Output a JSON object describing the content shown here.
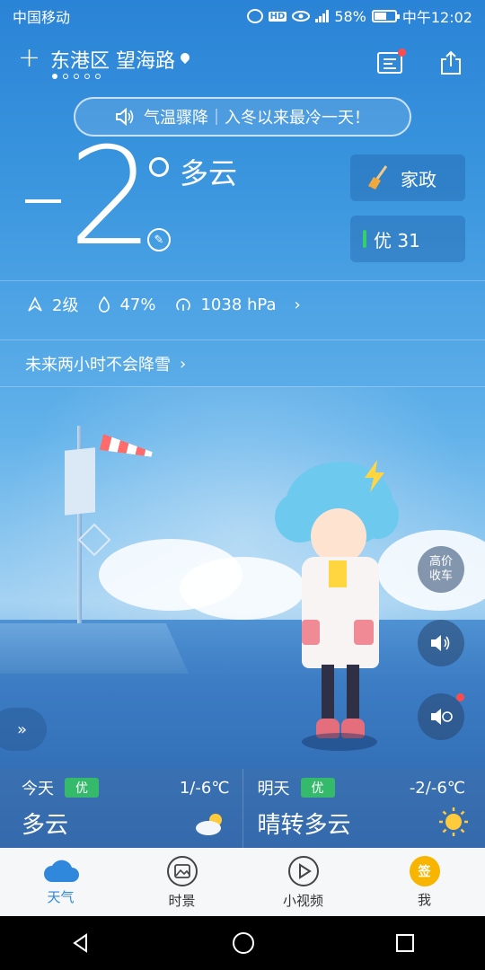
{
  "status_bar": {
    "carrier": "中国移动",
    "hd_label": "HD",
    "battery_percent": "58%",
    "battery_level": 0.58,
    "time": "中午12:02"
  },
  "header": {
    "location": "东港区 望海路",
    "page_count": 5,
    "active_page": 0
  },
  "alert": {
    "text": "气温骤降｜入冬以来最冷一天！"
  },
  "current": {
    "minus": "-",
    "temp": "2",
    "condition": "多云"
  },
  "side_cards": {
    "housekeeping_label": "家政",
    "aqi_label": "优 31"
  },
  "stats": {
    "wind": "2级",
    "humidity": "47%",
    "pressure": "1038 hPa"
  },
  "precip_note": "未来两小时不会降雪",
  "right_buttons": {
    "car_label_1": "高价",
    "car_label_2": "收车"
  },
  "forecast": {
    "today": {
      "day": "今天",
      "aqi": "优",
      "range": "1/-6℃",
      "condition": "多云",
      "icon": "partly-cloudy-icon"
    },
    "tomorrow": {
      "day": "明天",
      "aqi": "优",
      "range": "-2/-6℃",
      "condition": "晴转多云",
      "icon": "sun-icon"
    }
  },
  "nav": {
    "items": [
      {
        "label": "天气",
        "icon": "cloud-icon",
        "active": true
      },
      {
        "label": "时景",
        "icon": "photo-icon"
      },
      {
        "label": "小视频",
        "icon": "play-icon"
      },
      {
        "label": "我",
        "icon": "sign-in-icon",
        "badge": "签"
      }
    ]
  },
  "colors": {
    "accent": "#2f88db",
    "aqi_good": "#35b96b",
    "notification": "#ff4b4b"
  }
}
